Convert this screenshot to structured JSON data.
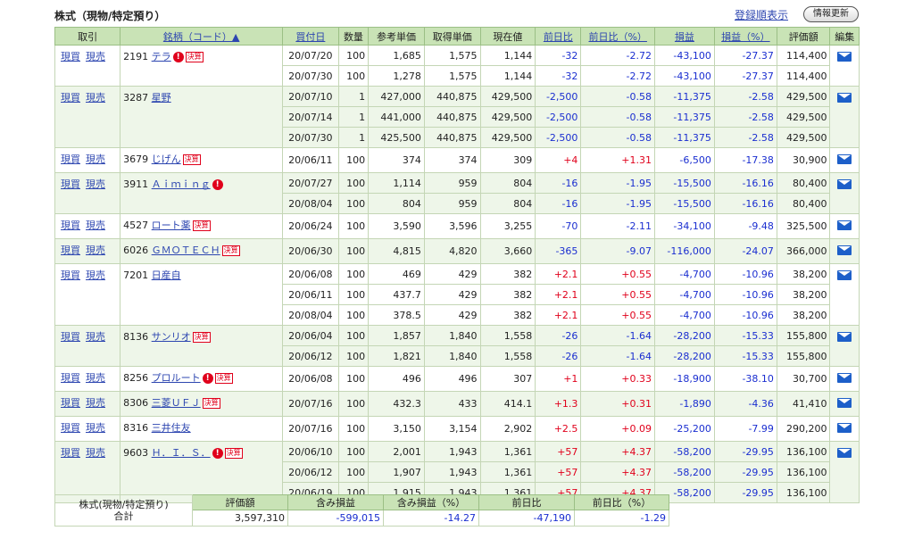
{
  "header": {
    "title": "株式（現物/特定預り）",
    "reg_link": "登録順表示",
    "refresh": "情報更新"
  },
  "columns": [
    "取引",
    "銘柄（コード）▲",
    "買付日",
    "数量",
    "参考単価",
    "取得単価",
    "現在値",
    "前日比",
    "前日比（%）",
    "損益",
    "損益（%）",
    "評価額",
    "編集"
  ],
  "link_columns": [
    1,
    2,
    7,
    8,
    9,
    10
  ],
  "trade_buy": "現買",
  "trade_sell": "現売",
  "holdings": [
    {
      "code": "2191",
      "name": "テラ",
      "warn": true,
      "kessan": "決算",
      "rows": [
        [
          "20/07/20",
          "100",
          "1,685",
          "1,575",
          "1,144",
          "-32",
          "-2.72",
          "-43,100",
          "-27.37",
          "114,400"
        ],
        [
          "20/07/30",
          "100",
          "1,278",
          "1,575",
          "1,144",
          "-32",
          "-2.72",
          "-43,100",
          "-27.37",
          "114,400"
        ]
      ]
    },
    {
      "code": "3287",
      "name": "星野",
      "warn": false,
      "kessan": "",
      "rows": [
        [
          "20/07/10",
          "1",
          "427,000",
          "440,875",
          "429,500",
          "-2,500",
          "-0.58",
          "-11,375",
          "-2.58",
          "429,500"
        ],
        [
          "20/07/14",
          "1",
          "441,000",
          "440,875",
          "429,500",
          "-2,500",
          "-0.58",
          "-11,375",
          "-2.58",
          "429,500"
        ],
        [
          "20/07/30",
          "1",
          "425,500",
          "440,875",
          "429,500",
          "-2,500",
          "-0.58",
          "-11,375",
          "-2.58",
          "429,500"
        ]
      ]
    },
    {
      "code": "3679",
      "name": "じげん",
      "warn": false,
      "kessan": "決算",
      "rows": [
        [
          "20/06/11",
          "100",
          "374",
          "374",
          "309",
          "+4",
          "+1.31",
          "-6,500",
          "-17.38",
          "30,900"
        ]
      ]
    },
    {
      "code": "3911",
      "name": "Ａｉｍｉｎｇ",
      "warn": true,
      "kessan": "",
      "rows": [
        [
          "20/07/27",
          "100",
          "1,114",
          "959",
          "804",
          "-16",
          "-1.95",
          "-15,500",
          "-16.16",
          "80,400"
        ],
        [
          "20/08/04",
          "100",
          "804",
          "959",
          "804",
          "-16",
          "-1.95",
          "-15,500",
          "-16.16",
          "80,400"
        ]
      ]
    },
    {
      "code": "4527",
      "name": "ロート薬",
      "warn": false,
      "kessan": "決算",
      "rows": [
        [
          "20/06/24",
          "100",
          "3,590",
          "3,596",
          "3,255",
          "-70",
          "-2.11",
          "-34,100",
          "-9.48",
          "325,500"
        ]
      ]
    },
    {
      "code": "6026",
      "name": "ＧＭＯＴＥＣＨ",
      "warn": false,
      "kessan": "決算",
      "rows": [
        [
          "20/06/30",
          "100",
          "4,815",
          "4,820",
          "3,660",
          "-365",
          "-9.07",
          "-116,000",
          "-24.07",
          "366,000"
        ]
      ]
    },
    {
      "code": "7201",
      "name": "日産自",
      "warn": false,
      "kessan": "",
      "rows": [
        [
          "20/06/08",
          "100",
          "469",
          "429",
          "382",
          "+2.1",
          "+0.55",
          "-4,700",
          "-10.96",
          "38,200"
        ],
        [
          "20/06/11",
          "100",
          "437.7",
          "429",
          "382",
          "+2.1",
          "+0.55",
          "-4,700",
          "-10.96",
          "38,200"
        ],
        [
          "20/08/04",
          "100",
          "378.5",
          "429",
          "382",
          "+2.1",
          "+0.55",
          "-4,700",
          "-10.96",
          "38,200"
        ]
      ]
    },
    {
      "code": "8136",
      "name": "サンリオ",
      "warn": false,
      "kessan": "決算",
      "rows": [
        [
          "20/06/04",
          "100",
          "1,857",
          "1,840",
          "1,558",
          "-26",
          "-1.64",
          "-28,200",
          "-15.33",
          "155,800"
        ],
        [
          "20/06/12",
          "100",
          "1,821",
          "1,840",
          "1,558",
          "-26",
          "-1.64",
          "-28,200",
          "-15.33",
          "155,800"
        ]
      ]
    },
    {
      "code": "8256",
      "name": "プロルート",
      "warn": true,
      "kessan": "決算",
      "rows": [
        [
          "20/06/08",
          "100",
          "496",
          "496",
          "307",
          "+1",
          "+0.33",
          "-18,900",
          "-38.10",
          "30,700"
        ]
      ]
    },
    {
      "code": "8306",
      "name": "三菱ＵＦＪ",
      "warn": false,
      "kessan": "決算",
      "rows": [
        [
          "20/07/16",
          "100",
          "432.3",
          "433",
          "414.1",
          "+1.3",
          "+0.31",
          "-1,890",
          "-4.36",
          "41,410"
        ]
      ]
    },
    {
      "code": "8316",
      "name": "三井住友",
      "warn": false,
      "kessan": "",
      "rows": [
        [
          "20/07/16",
          "100",
          "3,150",
          "3,154",
          "2,902",
          "+2.5",
          "+0.09",
          "-25,200",
          "-7.99",
          "290,200"
        ]
      ]
    },
    {
      "code": "9603",
      "name": "Ｈ．Ｉ．Ｓ．",
      "warn": true,
      "kessan": "決算",
      "rows": [
        [
          "20/06/10",
          "100",
          "2,001",
          "1,943",
          "1,361",
          "+57",
          "+4.37",
          "-58,200",
          "-29.95",
          "136,100"
        ],
        [
          "20/06/12",
          "100",
          "1,907",
          "1,943",
          "1,361",
          "+57",
          "+4.37",
          "-58,200",
          "-29.95",
          "136,100"
        ],
        [
          "20/06/19",
          "100",
          "1,915",
          "1,943",
          "1,361",
          "+57",
          "+4.37",
          "-58,200",
          "-29.95",
          "136,100"
        ]
      ]
    }
  ],
  "summary": {
    "label_line1": "株式(現物/特定預り)",
    "label_line2": "合計",
    "headers": [
      "評価額",
      "含み損益",
      "含み損益（%）",
      "前日比",
      "前日比（%）"
    ],
    "values": [
      "3,597,310",
      "-599,015",
      "-14.27",
      "-47,190",
      "-1.29"
    ]
  },
  "colors": {
    "negative": "#1a2ed0",
    "positive": "#e0001b",
    "header_bg": "#c9e3b6",
    "link": "#2d46b0"
  }
}
